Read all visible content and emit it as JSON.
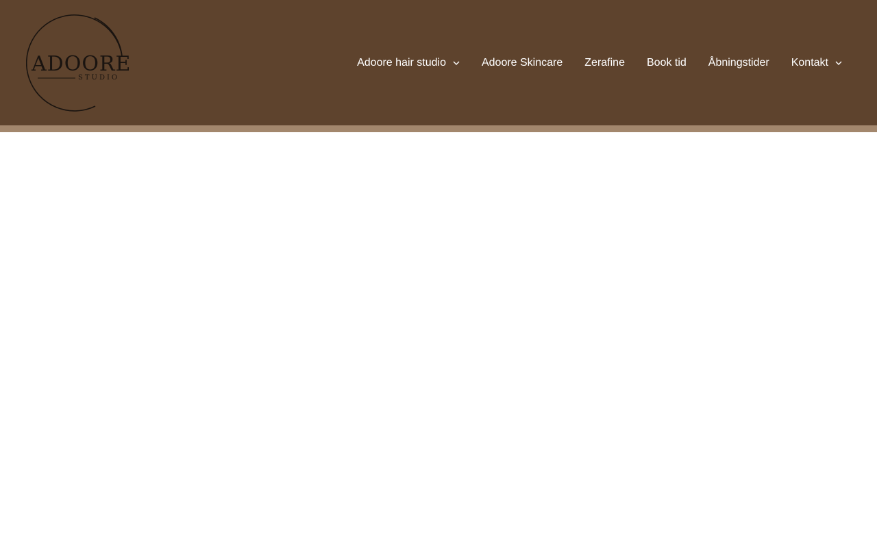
{
  "brand": {
    "logo_text": "ADOORE",
    "logo_subtext": "STUDIO",
    "logo_icon": "circle-arc-logo"
  },
  "colors": {
    "header_background": "#5e432d",
    "header_stripe": "#a3876d",
    "nav_text": "#ffffff",
    "page_background": "#ffffff",
    "logo_ink": "#1a1410"
  },
  "nav": {
    "items": [
      {
        "label": "Adoore hair studio",
        "has_dropdown": true
      },
      {
        "label": "Adoore Skincare",
        "has_dropdown": false
      },
      {
        "label": "Zerafine",
        "has_dropdown": false
      },
      {
        "label": "Book tid",
        "has_dropdown": false
      },
      {
        "label": "Åbningstider",
        "has_dropdown": false
      },
      {
        "label": "Kontakt",
        "has_dropdown": true
      }
    ],
    "dropdown_icon": "chevron-down-icon"
  }
}
